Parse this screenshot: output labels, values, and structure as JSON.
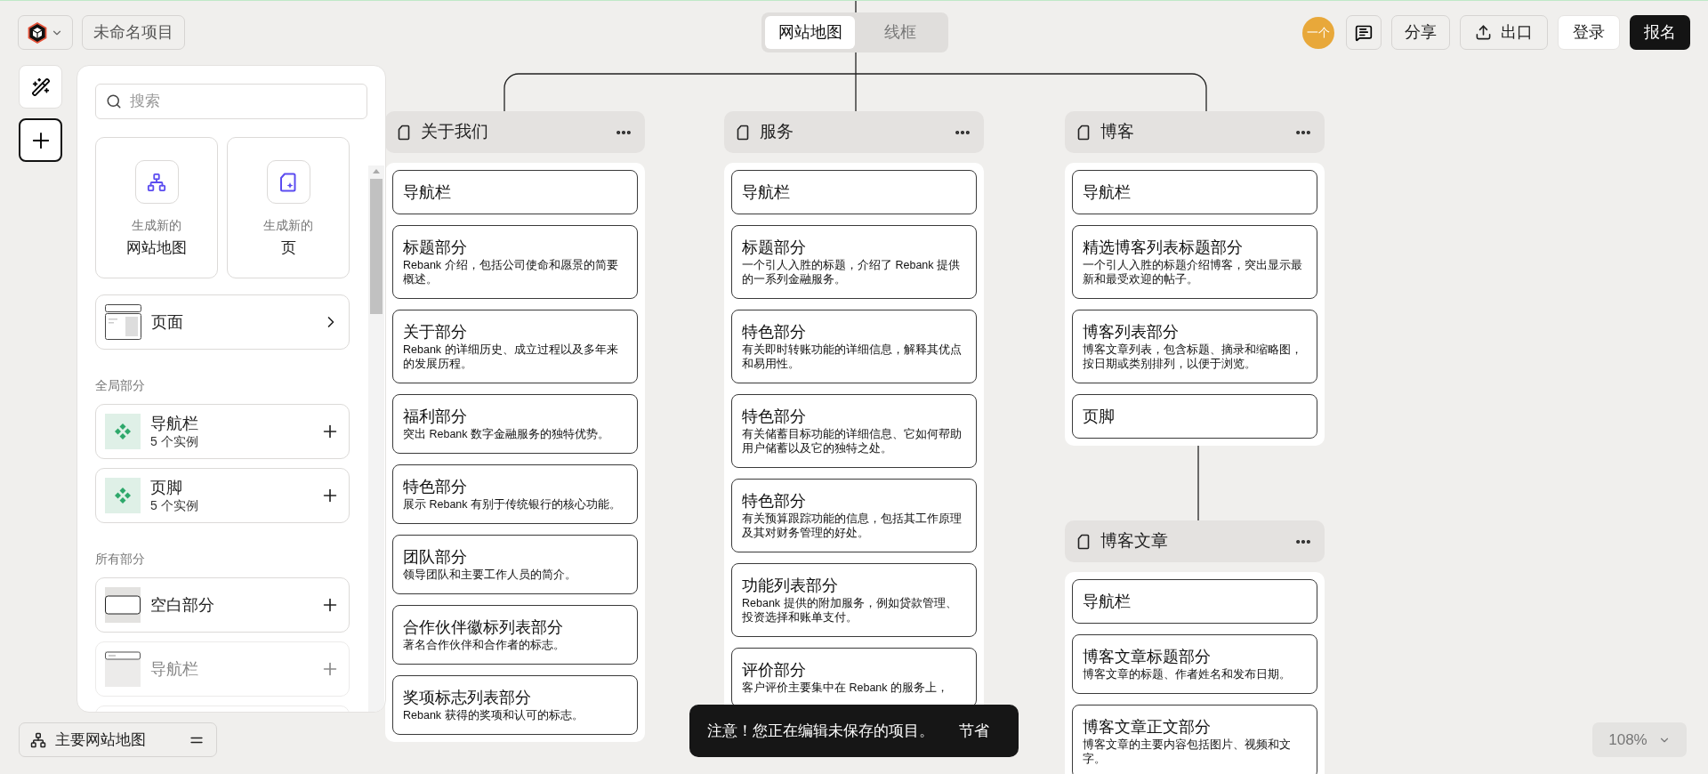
{
  "topbar": {
    "project_name": "未命名项目",
    "view_tabs": [
      {
        "label": "网站地图",
        "selected": true
      },
      {
        "label": "线框",
        "selected": false
      }
    ],
    "avatar": "一个",
    "buttons": [
      {
        "label": "分享",
        "kind": "outline"
      },
      {
        "label": "出口",
        "kind": "export"
      },
      {
        "label": "登录",
        "kind": "plain"
      },
      {
        "label": "报名",
        "kind": "primary"
      }
    ]
  },
  "panel": {
    "search": {
      "placeholder": "搜索"
    },
    "generate": [
      {
        "caption": "生成新的",
        "title": "网站地图",
        "kind": "sitemap"
      },
      {
        "caption": "生成新的",
        "title": "页",
        "kind": "page"
      }
    ],
    "pages_row": {
      "label": "页面"
    },
    "groups": [
      {
        "heading": "全局部分",
        "items": [
          {
            "label": "导航栏",
            "count": "5 个实例",
            "kind": "global",
            "disabled": false
          },
          {
            "label": "页脚",
            "count": "5 个实例",
            "kind": "global",
            "disabled": false
          }
        ]
      },
      {
        "heading": "所有部分",
        "items": [
          {
            "label": "空白部分",
            "kind": "blank",
            "disabled": false
          },
          {
            "label": "导航栏",
            "kind": "navbar",
            "disabled": true
          }
        ]
      }
    ]
  },
  "sitemap": {
    "pages": [
      {
        "title": "关于我们",
        "sections": [
          {
            "title": "导航栏"
          },
          {
            "title": "标题部分",
            "description": "Rebank 介绍，包括公司使命和愿景的简要概述。"
          },
          {
            "title": "关于部分",
            "description": "Rebank 的详细历史、成立过程以及多年来的发展历程。"
          },
          {
            "title": "福利部分",
            "description": "突出 Rebank 数字金融服务的独特优势。"
          },
          {
            "title": "特色部分",
            "description": "展示 Rebank 有别于传统银行的核心功能。"
          },
          {
            "title": "团队部分",
            "description": "领导团队和主要工作人员的简介。"
          },
          {
            "title": "合作伙伴徽标列表部分",
            "description": "著名合作伙伴和合作者的标志。"
          },
          {
            "title": "奖项标志列表部分",
            "description": "Rebank 获得的奖项和认可的标志。"
          }
        ]
      },
      {
        "title": "服务",
        "sections": [
          {
            "title": "导航栏"
          },
          {
            "title": "标题部分",
            "description": "一个引人入胜的标题，介绍了 Rebank 提供的一系列金融服务。"
          },
          {
            "title": "特色部分",
            "description": "有关即时转账功能的详细信息，解释其优点和易用性。"
          },
          {
            "title": "特色部分",
            "description": "有关储蓄目标功能的详细信息、它如何帮助用户储蓄以及它的独特之处。"
          },
          {
            "title": "特色部分",
            "description": "有关预算跟踪功能的信息，包括其工作原理及其对财务管理的好处。"
          },
          {
            "title": "功能列表部分",
            "description": "Rebank 提供的附加服务，例如贷款管理、投资选择和账单支付。"
          },
          {
            "title": "评价部分",
            "description": "客户评价主要集中在 Rebank 的服务上，"
          }
        ]
      },
      {
        "title": "博客",
        "sections": [
          {
            "title": "导航栏"
          },
          {
            "title": "精选博客列表标题部分",
            "description": "一个引人入胜的标题介绍博客，突出显示最新和最受欢迎的帖子。"
          },
          {
            "title": "博客列表部分",
            "description": "博客文章列表，包含标题、摘录和缩略图，按日期或类别排列，以便于浏览。"
          },
          {
            "title": "页脚"
          }
        ],
        "children": [
          {
            "title": "博客文章",
            "sections": [
              {
                "title": "导航栏"
              },
              {
                "title": "博客文章标题部分",
                "description": "博客文章的标题、作者姓名和发布日期。"
              },
              {
                "title": "博客文章正文部分",
                "description": "博客文章的主要内容包括图片、视频和文字。"
              }
            ]
          }
        ]
      }
    ]
  },
  "sitemap_selector": {
    "label": "主要网站地图"
  },
  "toast": {
    "message": "注意！您正在编辑未保存的项目。",
    "action": "节省"
  },
  "zoom": {
    "value": "108%"
  }
}
